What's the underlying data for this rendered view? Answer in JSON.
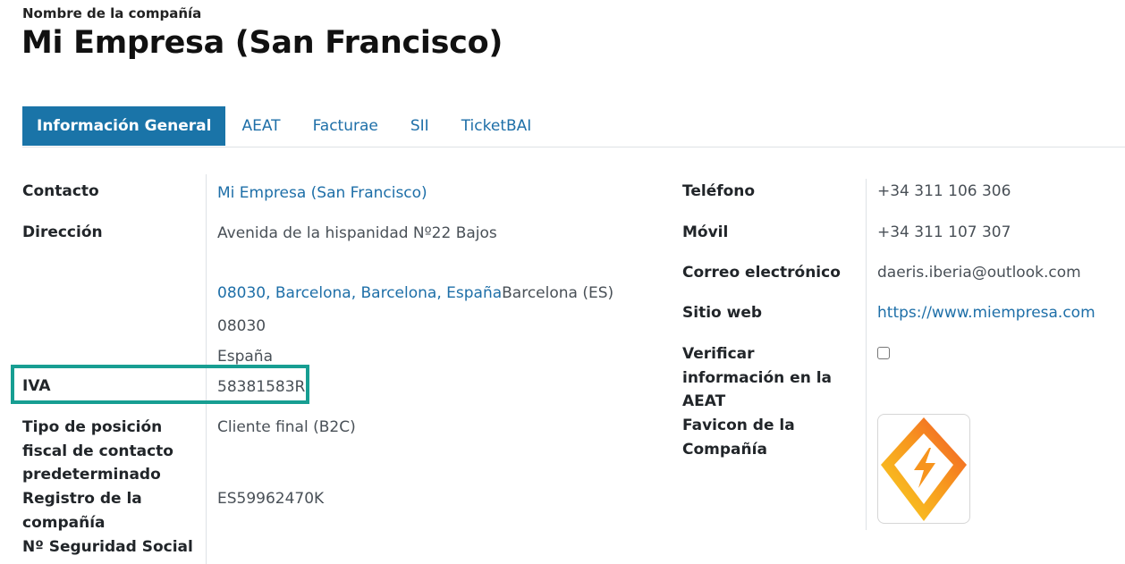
{
  "header": {
    "label": "Nombre de la compañía",
    "company_name": "Mi Empresa (San Francisco)"
  },
  "tabs": [
    {
      "label": "Información General",
      "active": true
    },
    {
      "label": "AEAT",
      "active": false
    },
    {
      "label": "Facturae",
      "active": false
    },
    {
      "label": "SII",
      "active": false
    },
    {
      "label": "TicketBAI",
      "active": false
    }
  ],
  "left": {
    "contacto_label": "Contacto",
    "contacto_value": "Mi Empresa (San Francisco)",
    "direccion_label": "Dirección",
    "direccion_street": "Avenida de la hispanidad Nº22 Bajos",
    "direccion_city_link": "08030, Barcelona, Barcelona, España",
    "direccion_city_state": "Barcelona (ES)",
    "direccion_zip": "08030",
    "direccion_country": "España",
    "iva_label": "IVA",
    "iva_value": "58381583R",
    "fiscal_label_1": "Tipo de posición",
    "fiscal_label_2": "fiscal de contacto",
    "fiscal_label_3": "predeterminado",
    "fiscal_value": "Cliente final (B2C)",
    "registro_label_1": "Registro de la",
    "registro_label_2": "compañía",
    "registro_value": "ES59962470K",
    "seguridad_label": "Nº Seguridad Social"
  },
  "right": {
    "telefono_label": "Teléfono",
    "telefono_value": "+34 311 106 306",
    "movil_label": "Móvil",
    "movil_value": "+34 311 107 307",
    "correo_label": "Correo electrónico",
    "correo_value": "daeris.iberia@outlook.com",
    "sitio_label": "Sitio web",
    "sitio_value": "https://www.miempresa.com",
    "verificar_label_1": "Verificar",
    "verificar_label_2": "información en la",
    "verificar_label_3": "AEAT",
    "verificar_checked": false,
    "favicon_label_1": "Favicon de la",
    "favicon_label_2": "Compañía"
  },
  "colors": {
    "accent": "#1a74a8",
    "link": "#1e6fa8",
    "highlight": "#179e92"
  }
}
